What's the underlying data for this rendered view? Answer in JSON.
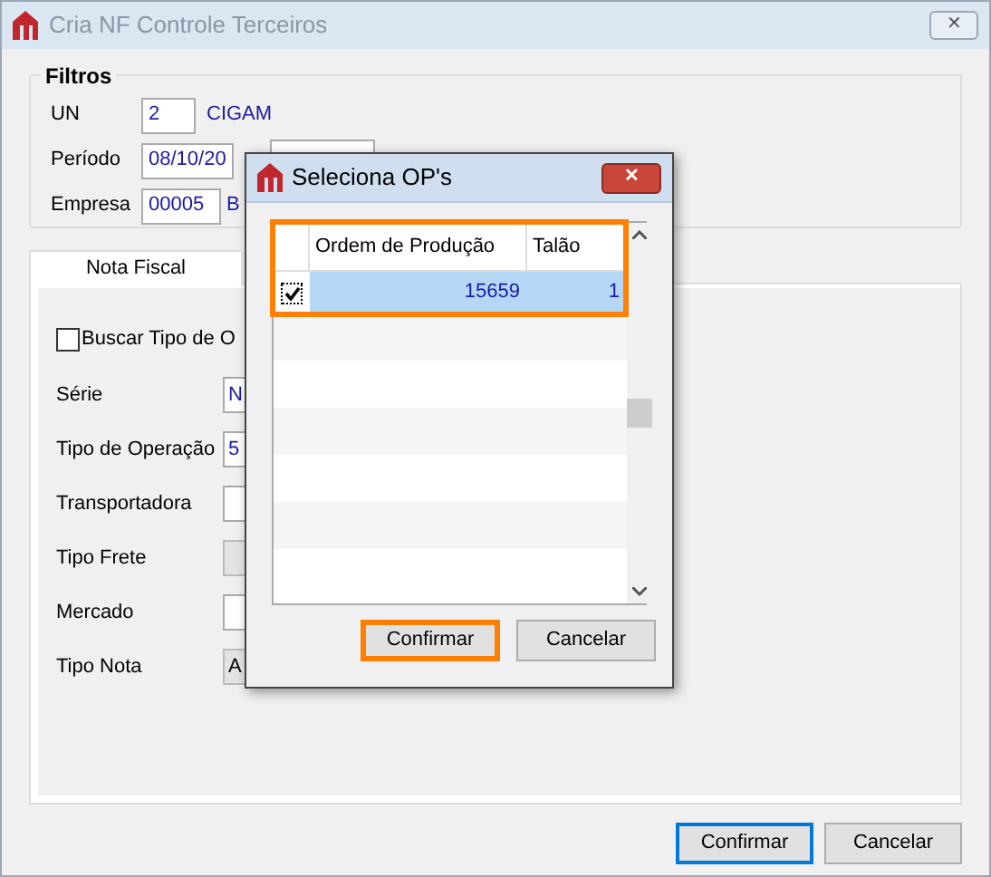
{
  "window": {
    "title": "Cria NF Controle Terceiros",
    "close": "✕"
  },
  "filters": {
    "title": "Filtros",
    "un": {
      "label": "UN",
      "value": "2",
      "description": "CIGAM"
    },
    "periodo": {
      "label": "Período",
      "value": "08/10/20"
    },
    "empresa": {
      "label": "Empresa",
      "value": "00005",
      "description": "B"
    }
  },
  "tabs": [
    {
      "label": "Nota Fiscal",
      "selected": true
    }
  ],
  "nota_fiscal": {
    "checkbox": {
      "label": "Buscar Tipo de O",
      "checked": false
    },
    "fields": [
      {
        "label": "Série",
        "value": "N",
        "disabled": false
      },
      {
        "label": "Tipo de Operação",
        "value": "5",
        "disabled": false
      },
      {
        "label": "Transportadora",
        "disabled": false
      },
      {
        "label": "Tipo Frete",
        "disabled": true
      },
      {
        "label": "Mercado",
        "disabled": false
      },
      {
        "label": "Tipo Nota",
        "value": "A",
        "disabled": true
      }
    ]
  },
  "buttons": [
    {
      "label": "Confirmar",
      "default": true
    },
    {
      "label": "Cancelar",
      "default": false
    }
  ],
  "dialog": {
    "title": "Seleciona OP's",
    "close": "✕",
    "grid": {
      "highlighted": true,
      "columns": [
        "Ordem de Produção",
        "Talão"
      ],
      "rows": [
        {
          "checked": true,
          "selected": true,
          "cells": [
            "15659",
            "1"
          ]
        }
      ]
    },
    "buttons": [
      {
        "label": "Confirmar",
        "highlighted": true
      },
      {
        "label": "Cancelar",
        "highlighted": false
      }
    ]
  }
}
